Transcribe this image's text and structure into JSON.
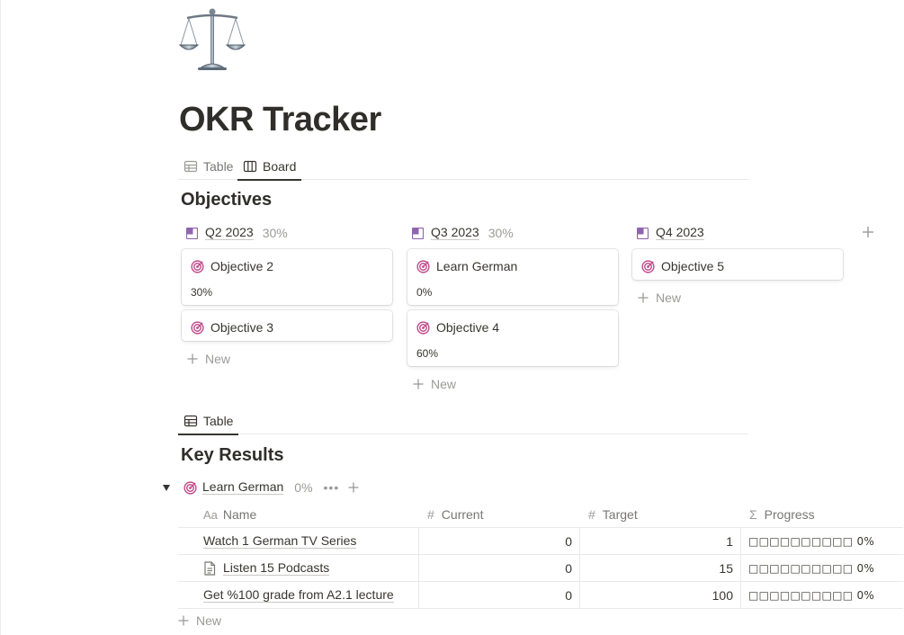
{
  "page": {
    "icon": "balance-scale-icon",
    "title": "OKR Tracker"
  },
  "view_tabs": [
    {
      "label": "Table",
      "icon": "table-icon",
      "active": false
    },
    {
      "label": "Board",
      "icon": "board-icon",
      "active": true
    }
  ],
  "board": {
    "title": "Objectives",
    "columns": [
      {
        "name": "Q2 2023",
        "pct": "30%",
        "cards": [
          {
            "title": "Objective 2",
            "value": "30%"
          },
          {
            "title": "Objective 3",
            "value": ""
          }
        ],
        "new_label": "New"
      },
      {
        "name": "Q3 2023",
        "pct": "30%",
        "cards": [
          {
            "title": "Learn German",
            "value": "0%"
          },
          {
            "title": "Objective 4",
            "value": "60%"
          }
        ],
        "new_label": "New"
      },
      {
        "name": "Q4 2023",
        "pct": "",
        "cards": [
          {
            "title": "Objective 5",
            "value": ""
          }
        ],
        "new_label": "New"
      }
    ]
  },
  "lower_tabs": [
    {
      "label": "Table",
      "icon": "table-icon",
      "active": true
    }
  ],
  "key_results": {
    "title": "Key Results",
    "group": {
      "name": "Learn German",
      "pct": "0%",
      "more": "•••"
    },
    "columns": {
      "name": "Name",
      "name_icon": "Aa",
      "current": "Current",
      "current_icon": "#",
      "target": "Target",
      "target_icon": "#",
      "progress": "Progress",
      "progress_icon": "Σ"
    },
    "rows": [
      {
        "name": "Watch 1 German TV Series",
        "current": "0",
        "target": "1",
        "progress": "□□□□□□□□□□ 0%",
        "has_doc_icon": false
      },
      {
        "name": "Listen 15 Podcasts",
        "current": "0",
        "target": "15",
        "progress": "□□□□□□□□□□ 0%",
        "has_doc_icon": true
      },
      {
        "name": "Get %100 grade from A2.1 lecture",
        "current": "0",
        "target": "100",
        "progress": "□□□□□□□□□□ 0%",
        "has_doc_icon": false
      }
    ],
    "new_label": "New"
  },
  "colors": {
    "accent_purple": "#9065b0",
    "target_pink": "#c14c8a",
    "text": "#37352f",
    "muted": "#9b9a97"
  }
}
